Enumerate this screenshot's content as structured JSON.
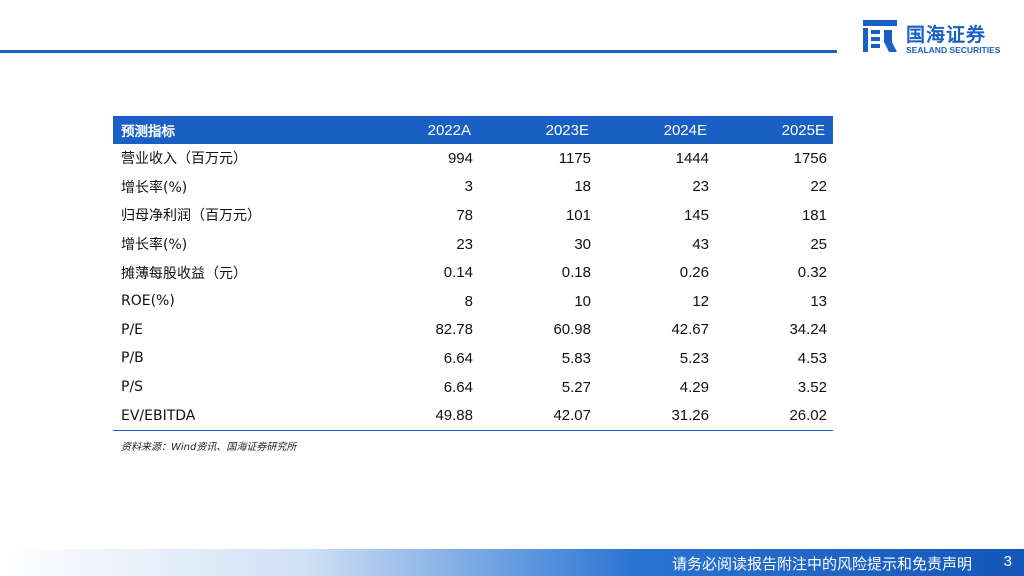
{
  "brand": {
    "name_cn": "国海证券",
    "name_en": "SEALAND SECURITIES",
    "icon": "sealand-logo-icon",
    "color": "#1a5fc4"
  },
  "table": {
    "headers": [
      "预测指标",
      "2022A",
      "2023E",
      "2024E",
      "2025E"
    ],
    "rows": [
      {
        "label": "营业收入（百万元）",
        "values": [
          "994",
          "1175",
          "1444",
          "1756"
        ]
      },
      {
        "label": "增长率(%)",
        "values": [
          "3",
          "18",
          "23",
          "22"
        ]
      },
      {
        "label": "归母净利润（百万元）",
        "values": [
          "78",
          "101",
          "145",
          "181"
        ]
      },
      {
        "label": "增长率(%)",
        "values": [
          "23",
          "30",
          "43",
          "25"
        ]
      },
      {
        "label": "摊薄每股收益（元）",
        "values": [
          "0.14",
          "0.18",
          "0.26",
          "0.32"
        ]
      },
      {
        "label": "ROE(%)",
        "values": [
          "8",
          "10",
          "12",
          "13"
        ]
      },
      {
        "label": "P/E",
        "values": [
          "82.78",
          "60.98",
          "42.67",
          "34.24"
        ]
      },
      {
        "label": "P/B",
        "values": [
          "6.64",
          "5.83",
          "5.23",
          "4.53"
        ]
      },
      {
        "label": "P/S",
        "values": [
          "6.64",
          "5.27",
          "4.29",
          "3.52"
        ]
      },
      {
        "label": "EV/EBITDA",
        "values": [
          "49.88",
          "42.07",
          "31.26",
          "26.02"
        ]
      }
    ]
  },
  "source_note": "资料来源：Wind资讯、国海证券研究所",
  "footer": {
    "disclaimer": "请务必阅读报告附注中的风险提示和免责声明",
    "page_number": "3"
  }
}
